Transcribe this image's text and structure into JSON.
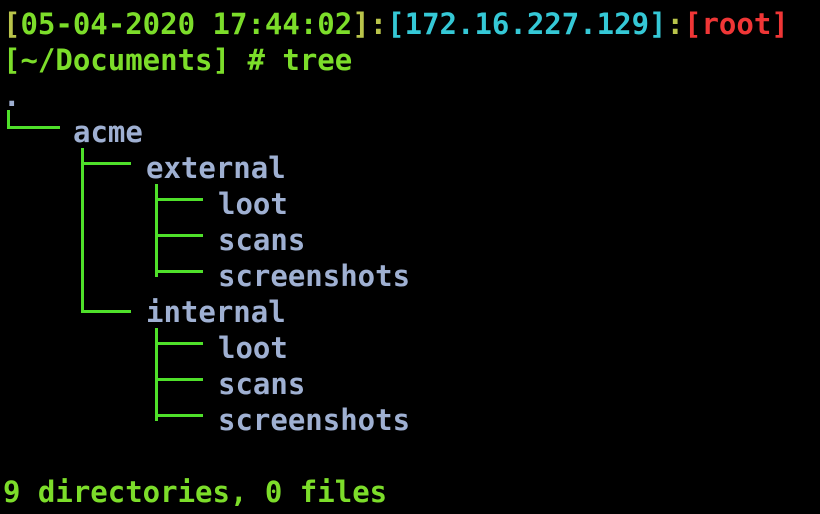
{
  "prompt": {
    "open_bracket": "[",
    "timestamp": "05-04-2020 17:44:02",
    "close_bracket": "]",
    "sep1": ":",
    "ip_open": "[",
    "ip": "172.16.227.129",
    "ip_close": "]",
    "sep2": ":",
    "user_open": "[",
    "user": "root",
    "user_close": "]",
    "cwd": "[~/Documents]",
    "symbol": "#",
    "command": "tree"
  },
  "tree": {
    "root": ".",
    "acme": "acme",
    "external": "external",
    "external_children": [
      "loot",
      "scans",
      "screenshots"
    ],
    "internal": "internal",
    "internal_children": [
      "loot",
      "scans",
      "screenshots"
    ]
  },
  "summary": "9 directories, 0 files",
  "colors": {
    "prompt_green": "#7cdd2a",
    "ip_cyan": "#35c8d6",
    "root_red": "#ef3636",
    "timestamp_yellow": "#b9c44a",
    "directory_blue": "#9fb0d2",
    "tree_line_green": "#4fe02a",
    "background": "#000000"
  }
}
